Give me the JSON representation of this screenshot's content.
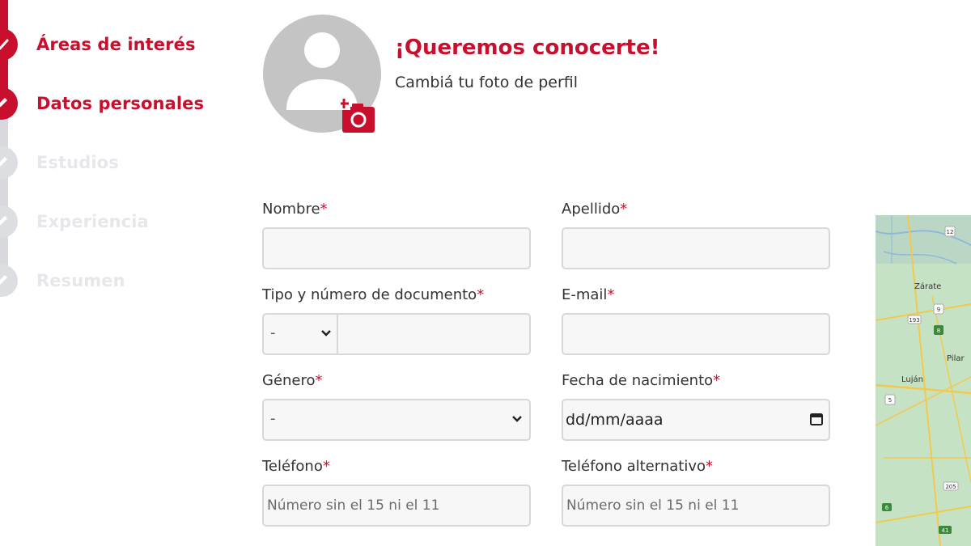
{
  "stepper": {
    "steps": [
      {
        "label": "Áreas de interés",
        "state": "done",
        "icon": "check-icon"
      },
      {
        "label": "Datos personales",
        "state": "current",
        "icon": "pencil-icon"
      },
      {
        "label": "Estudios",
        "state": "pending",
        "icon": "pencil-icon"
      },
      {
        "label": "Experiencia",
        "state": "pending",
        "icon": "pencil-icon"
      },
      {
        "label": "Resumen",
        "state": "pending",
        "icon": "pencil-icon"
      }
    ]
  },
  "profile": {
    "title": "¡Queremos conocerte!",
    "subtitle": "Cambiá tu foto de perfil",
    "avatar_icon": "user-placeholder-icon",
    "camera_icon": "add-camera-icon"
  },
  "form": {
    "required_mark": "*",
    "nombre": {
      "label": "Nombre",
      "value": ""
    },
    "apellido": {
      "label": "Apellido",
      "value": ""
    },
    "documento": {
      "label": "Tipo y número de documento",
      "type_value": "-",
      "number_value": ""
    },
    "email": {
      "label": "E-mail",
      "value": ""
    },
    "genero": {
      "label": "Género",
      "value": "-"
    },
    "fecha": {
      "label": "Fecha de nacimiento",
      "value": "dd/mm/aaaa"
    },
    "telefono": {
      "label": "Teléfono",
      "placeholder": "Número sin el 15 ni el 11"
    },
    "telefono_alt": {
      "label": "Teléfono alternativo",
      "placeholder": "Número sin el 15 ni el 11"
    }
  },
  "map": {
    "labels": [
      "Zárate",
      "Pilar",
      "Luján"
    ],
    "route_numbers": [
      "12",
      "193",
      "9",
      "8",
      "5",
      "205",
      "41",
      "6"
    ]
  },
  "colors": {
    "brand": "#c8102e",
    "pending": "#dcdee2",
    "input_bg": "#f7f7f7",
    "input_border": "#d8d8d8"
  }
}
